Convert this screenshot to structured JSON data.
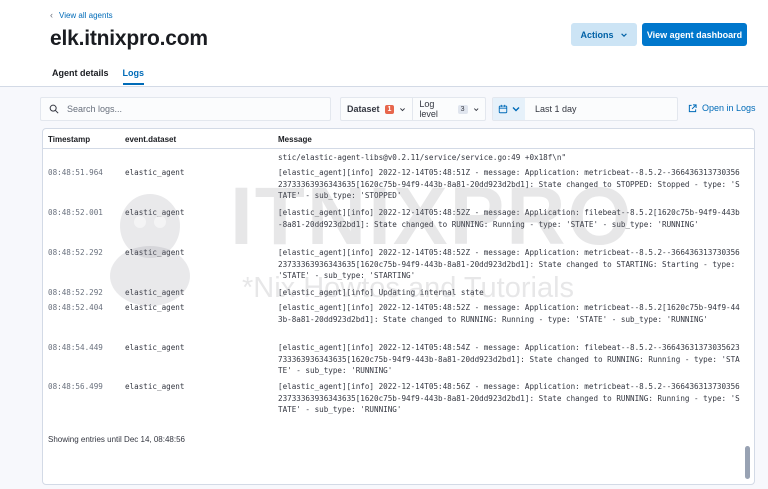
{
  "header": {
    "back_label": "View all agents",
    "title": "elk.itnixpro.com",
    "actions_label": "Actions",
    "dashboard_label": "View agent dashboard",
    "tabs": [
      {
        "label": "Agent details",
        "active": false
      },
      {
        "label": "Logs",
        "active": true
      }
    ]
  },
  "toolbar": {
    "search_placeholder": "Search logs...",
    "dataset_label": "Dataset",
    "dataset_count": "1",
    "loglevel_label": "Log level",
    "loglevel_count": "3",
    "date_range": "Last 1 day",
    "open_in_logs": "Open in Logs"
  },
  "table": {
    "columns": [
      "Timestamp",
      "event.dataset",
      "Message"
    ],
    "partial_message": "stic/elastic-agent-libs@v0.2.11/service/service.go:49 +0x18f\\n\"",
    "rows": [
      {
        "time": "08:48:51.964",
        "dataset": "elastic_agent",
        "message": "[elastic_agent][info] 2022-12-14T05:48:51Z - message: Application: metricbeat--8.5.2--36643631373035623733363936343635[1620c75b-94f9-443b-8a81-20dd923d2bd1]: State changed to STOPPED: Stopped - type: 'STATE' - sub_type: 'STOPPED'"
      },
      {
        "time": "08:48:52.001",
        "dataset": "elastic_agent",
        "message": "[elastic_agent][info] 2022-12-14T05:48:52Z - message: Application: filebeat--8.5.2[1620c75b-94f9-443b-8a81-20dd923d2bd1]: State changed to RUNNING: Running - type: 'STATE' - sub_type: 'RUNNING'"
      },
      {
        "time": "08:48:52.292",
        "dataset": "elastic_agent",
        "message": "[elastic_agent][info] 2022-12-14T05:48:52Z - message: Application: metricbeat--8.5.2--36643631373035623733363936343635[1620c75b-94f9-443b-8a81-20dd923d2bd1]: State changed to STARTING: Starting - type: 'STATE' - sub_type: 'STARTING'"
      },
      {
        "time": "08:48:52.292",
        "dataset": "elastic_agent",
        "message": "[elastic_agent][info] Updating internal state"
      },
      {
        "time": "08:48:52.404",
        "dataset": "elastic_agent",
        "message": "[elastic_agent][info] 2022-12-14T05:48:52Z - message: Application: metricbeat--8.5.2[1620c75b-94f9-443b-8a81-20dd923d2bd1]: State changed to RUNNING: Running - type: 'STATE' - sub_type: 'RUNNING'"
      },
      {
        "time": "08:48:54.449",
        "dataset": "elastic_agent",
        "message": "[elastic_agent][info] 2022-12-14T05:48:54Z - message: Application: filebeat--8.5.2--36643631373035623733363936343635[1620c75b-94f9-443b-8a81-20dd923d2bd1]: State changed to RUNNING: Running - type: 'STATE' - sub_type: 'RUNNING'"
      },
      {
        "time": "08:48:56.499",
        "dataset": "elastic_agent",
        "message": "[elastic_agent][info] 2022-12-14T05:48:56Z - message: Application: metricbeat--8.5.2--36643631373035623733363936343635[1620c75b-94f9-443b-8a81-20dd923d2bd1]: State changed to RUNNING: Running - type: 'STATE' - sub_type: 'RUNNING'"
      }
    ],
    "footer": "Showing entries until Dec 14, 08:48:56"
  },
  "watermark": {
    "brand": "ITNIXPRO",
    "tagline": "*Nix Howtos and Tutorials"
  },
  "colors": {
    "accent": "#0077cc",
    "link": "#006bb8",
    "dataset_badge": "#e7664c"
  }
}
